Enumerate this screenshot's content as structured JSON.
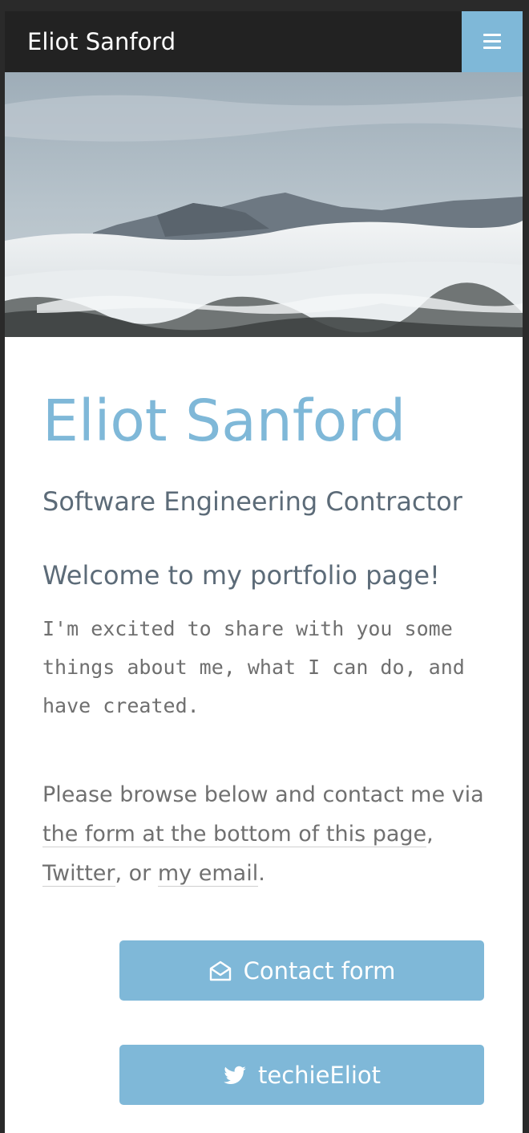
{
  "navbar": {
    "brand": "Eliot Sanford",
    "menu_icon": "hamburger-menu-icon"
  },
  "hero": {
    "image": "mountains-above-clouds-photo"
  },
  "main": {
    "title": "Eliot Sanford",
    "subtitle": "Software Engineering Contractor",
    "welcome_heading": "Welcome to my portfolio page!",
    "intro_text": "I'm excited to share with you some things about me, what I can do, and have created.",
    "browse_prefix": "Please browse below and contact me via ",
    "link_form": "the form at the bottom of this page",
    "sep_1": ", ",
    "link_twitter": "Twitter",
    "sep_2": ", or ",
    "link_email": "my email",
    "browse_suffix": "."
  },
  "buttons": {
    "contact": {
      "label": "Contact form",
      "icon": "envelope-open-icon"
    },
    "twitter": {
      "label": "techieEliot",
      "icon": "twitter-bird-icon"
    }
  },
  "colors": {
    "accent": "#7fb8d8",
    "navbar_bg": "#222222",
    "heading_text": "#5c6b78",
    "body_text": "#707070"
  }
}
